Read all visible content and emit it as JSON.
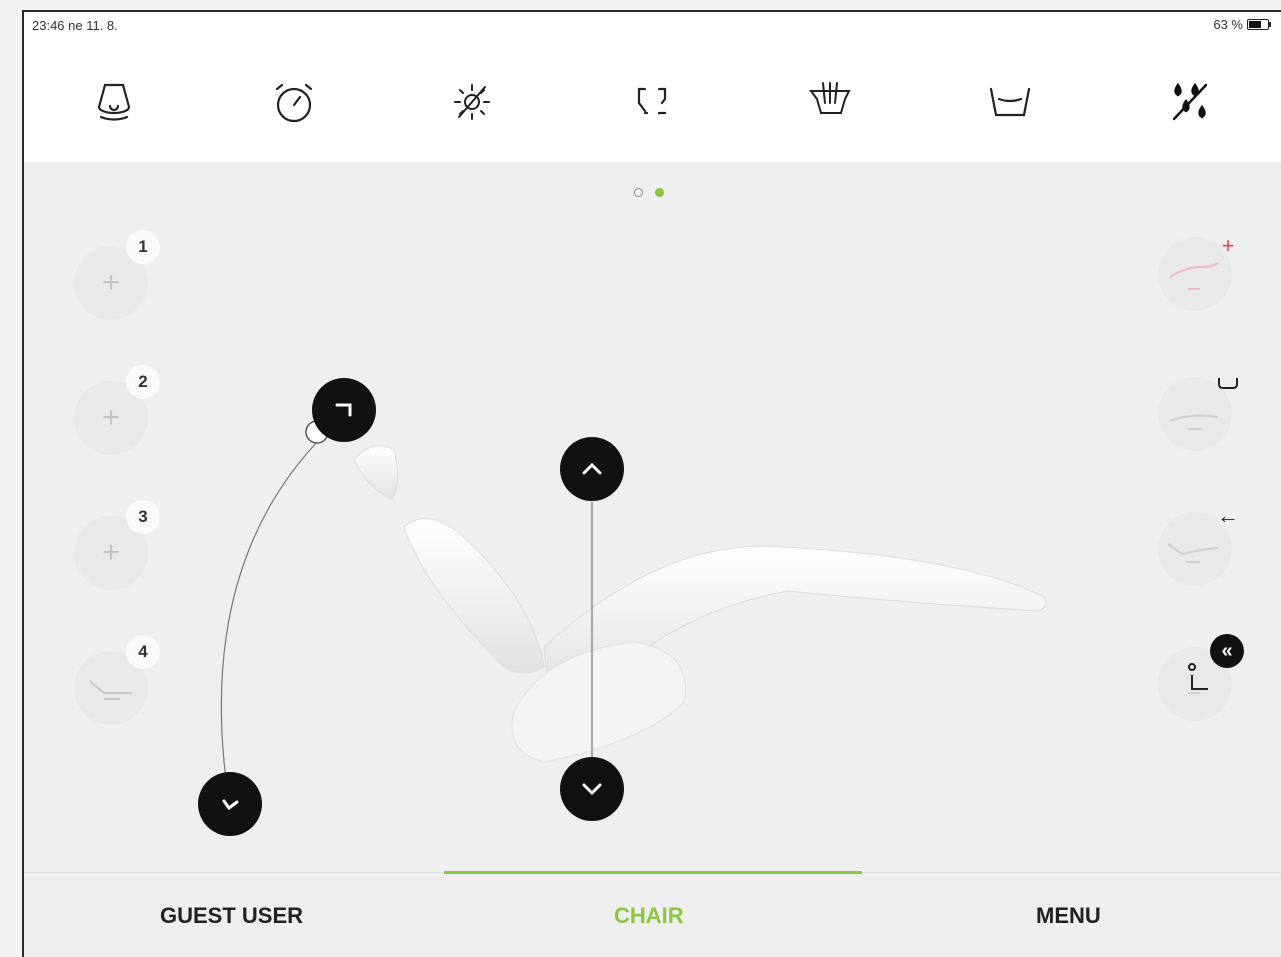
{
  "status": {
    "time_date": "23:46  ne 11. 8.",
    "battery": "63 %"
  },
  "toolbar": {
    "icons": [
      "operating-light-icon",
      "timer-icon",
      "light-off-icon",
      "scanner-frame-icon",
      "instrument-holder-icon",
      "cup-fill-icon",
      "water-off-icon"
    ]
  },
  "pager": {
    "pages": 2,
    "active_page": 2
  },
  "presets": [
    {
      "number": "1",
      "symbol": "+"
    },
    {
      "number": "2",
      "symbol": "+"
    },
    {
      "number": "3",
      "symbol": "+"
    },
    {
      "number": "4",
      "symbol": ""
    }
  ],
  "right_presets": [
    {
      "badge": "+",
      "badge_color": "#e8455f"
    },
    {
      "badge": "cup",
      "badge_color": "#222222"
    },
    {
      "badge": "←",
      "badge_color": "#222222"
    },
    {
      "badge": "«",
      "badge_color": "#111111"
    }
  ],
  "tabs": {
    "guest_user": "GUEST USER",
    "chair": "CHAIR",
    "menu": "MENU",
    "active": "CHAIR"
  },
  "colors": {
    "accent": "#8cc63f",
    "danger": "#e8455f"
  }
}
